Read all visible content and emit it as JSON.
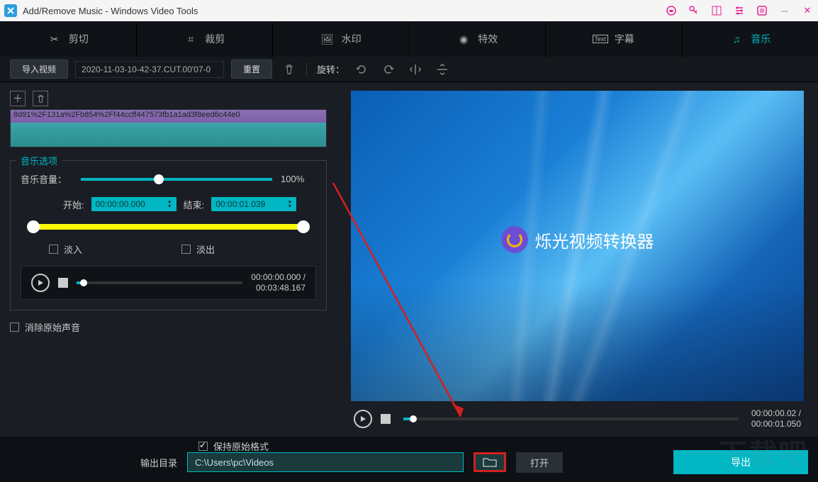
{
  "window": {
    "title": "Add/Remove Music - Windows Video Tools"
  },
  "tabs": {
    "cut": "剪切",
    "crop": "裁剪",
    "watermark": "水印",
    "effect": "特效",
    "subtitle": "字幕",
    "music": "音乐"
  },
  "toolbar": {
    "import": "导入视频",
    "filename": "2020-11-03-10-42-37.CUT.00'07-0",
    "reset": "重置",
    "rotate_label": "旋转："
  },
  "timeline": {
    "clip_name": "8d91%2F131a%2Fb854%2Ff44ccff447573fb1a1ad3f8eed6c44e0"
  },
  "music": {
    "panel_title": "音乐选项",
    "volume_label": "音乐音量：",
    "volume_pct": "100%",
    "start_label": "开始:",
    "start_time": "00:00:00.000",
    "end_label": "结束:",
    "end_time": "00:00:01.039",
    "fade_in": "淡入",
    "fade_out": "淡出",
    "player_cur": "00:00:00.000 /",
    "player_dur": "00:03:48.167",
    "remove_original": "消除原始声音"
  },
  "preview": {
    "watermark_text": "烁光视频转换器",
    "cur": "00:00:00.02 /",
    "dur": "00:00:01.050"
  },
  "footer": {
    "keep_format": "保持原始格式",
    "output_label": "输出目录",
    "output_path": "C:\\Users\\pc\\Videos",
    "open": "打开",
    "export": "导出"
  },
  "site_wm": "下载吧"
}
